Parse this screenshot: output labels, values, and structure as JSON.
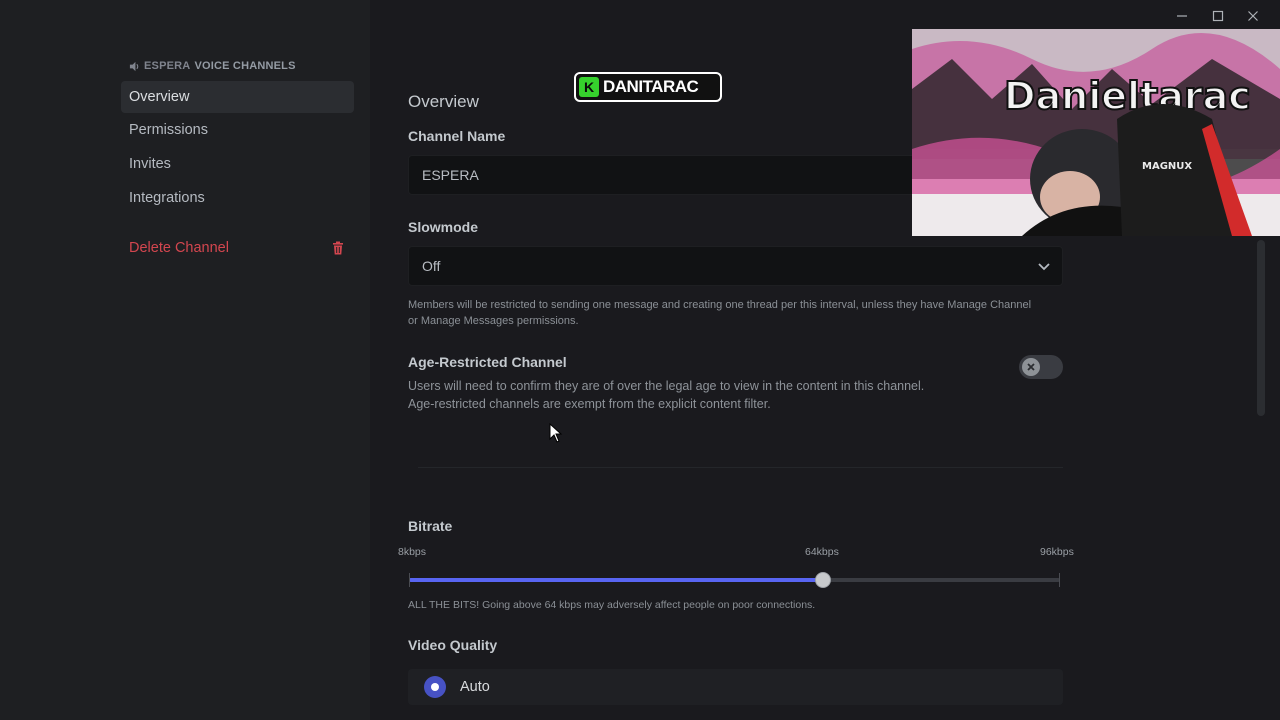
{
  "sidebar": {
    "category_prefix": "ESPERA",
    "category_label": "VOICE CHANNELS",
    "items": [
      {
        "label": "Overview"
      },
      {
        "label": "Permissions"
      },
      {
        "label": "Invites"
      },
      {
        "label": "Integrations"
      }
    ],
    "delete_label": "Delete Channel"
  },
  "overview": {
    "title": "Overview",
    "channel_name_label": "Channel Name",
    "channel_name_value": "ESPERA",
    "slowmode_label": "Slowmode",
    "slowmode_value": "Off",
    "slowmode_help_1": "Members will be restricted to sending one message and creating one thread per this interval, unless they have Manage Channel",
    "slowmode_help_2": "or Manage Messages permissions.",
    "age_label": "Age-Restricted Channel",
    "age_help_1": "Users will need to confirm they are of over the legal age to view in the content in this channel.",
    "age_help_2": "Age-restricted channels are exempt from the explicit content filter.",
    "age_enabled": false
  },
  "bitrate": {
    "label": "Bitrate",
    "min_label": "8kbps",
    "mid_label": "64kbps",
    "max_label": "96kbps",
    "min": 8,
    "max": 96,
    "value": 64,
    "help": "ALL THE BITS! Going above 64 kbps may adversely affect people on poor connections."
  },
  "video_quality": {
    "label": "Video Quality",
    "selected": "Auto"
  },
  "overlay": {
    "banner_badge": "K",
    "banner_text": "DANITARAC",
    "webcam_sign": "Danieltarac",
    "chair_text": "MAGNUX"
  },
  "colors": {
    "accent": "#5865f2",
    "danger": "#d3464f",
    "banner_green": "#36d12d"
  }
}
